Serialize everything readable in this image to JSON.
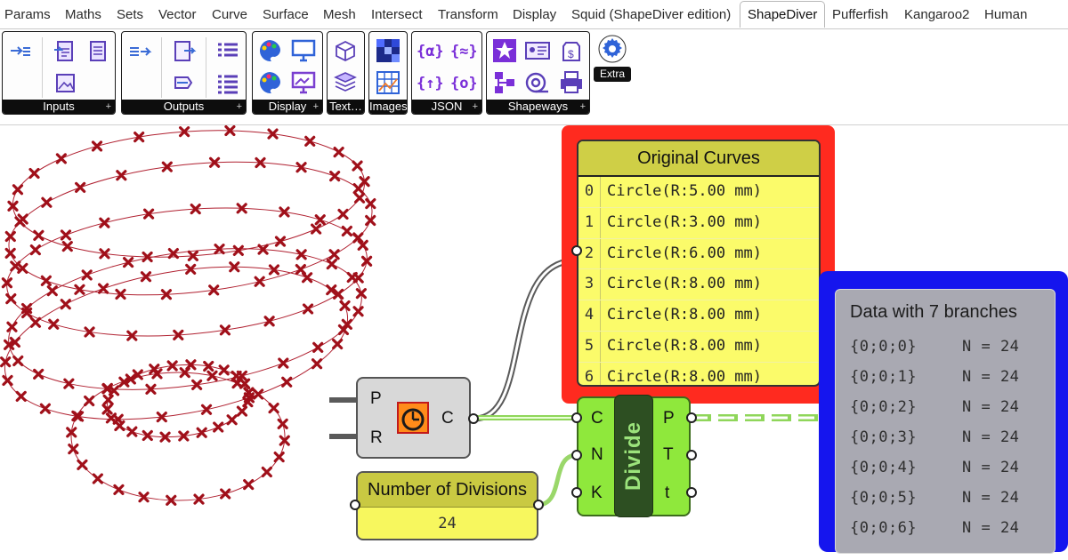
{
  "tabs": [
    {
      "label": "Params"
    },
    {
      "label": "Maths"
    },
    {
      "label": "Sets"
    },
    {
      "label": "Vector"
    },
    {
      "label": "Curve"
    },
    {
      "label": "Surface"
    },
    {
      "label": "Mesh"
    },
    {
      "label": "Intersect"
    },
    {
      "label": "Transform"
    },
    {
      "label": "Display"
    },
    {
      "label": "Squid (ShapeDiver edition)"
    },
    {
      "label": "ShapeDiver",
      "active": true
    },
    {
      "label": "Pufferfish"
    },
    {
      "label": "Kangaroo2"
    },
    {
      "label": "Human"
    }
  ],
  "ribbon": {
    "panels": [
      {
        "label": "Inputs",
        "icons": [
          "input-arrow-icon",
          "file-input-icon",
          "file-text-icon",
          "image-input-icon"
        ]
      },
      {
        "label": "Outputs",
        "icons": [
          "output-arrow-icon",
          "file-output-icon",
          "export-arrow-icon",
          "list-output-icon",
          "list-output-2-icon"
        ]
      },
      {
        "label": "Display",
        "icons": [
          "palette-icon",
          "monitor-icon",
          "palette-2-icon",
          "screen-display-icon"
        ]
      },
      {
        "label": "Text…",
        "icons": [
          "texture-box-icon",
          "texture-stack-icon"
        ]
      },
      {
        "label": "Images",
        "icons": [
          "image-grid-icon",
          "image-mesh-icon"
        ]
      },
      {
        "label": "JSON",
        "icons": [
          "json-object-icon",
          "json-array-icon",
          "json-list-icon",
          "json-dict-icon"
        ]
      },
      {
        "label": "Shapeways",
        "icons": [
          "shapeways-star-icon",
          "contact-card-icon",
          "price-tag-icon",
          "hierarchy-icon",
          "material-roll-icon",
          "printer-icon"
        ]
      }
    ],
    "extra_label": "Extra"
  },
  "components": {
    "original_curves": {
      "title": "Original Curves",
      "items": [
        {
          "index": "0",
          "value": "Circle(R:5.00 mm)"
        },
        {
          "index": "1",
          "value": "Circle(R:3.00 mm)"
        },
        {
          "index": "2",
          "value": "Circle(R:6.00 mm)"
        },
        {
          "index": "3",
          "value": "Circle(R:8.00 mm)"
        },
        {
          "index": "4",
          "value": "Circle(R:8.00 mm)"
        },
        {
          "index": "5",
          "value": "Circle(R:8.00 mm)"
        },
        {
          "index": "6",
          "value": "Circle(R:8.00 mm)"
        }
      ]
    },
    "data_panel": {
      "title": "Data with 7 branches",
      "rows": [
        {
          "path": "{0;0;0}",
          "count": "N = 24"
        },
        {
          "path": "{0;0;1}",
          "count": "N = 24"
        },
        {
          "path": "{0;0;2}",
          "count": "N = 24"
        },
        {
          "path": "{0;0;3}",
          "count": "N = 24"
        },
        {
          "path": "{0;0;4}",
          "count": "N = 24"
        },
        {
          "path": "{0;0;5}",
          "count": "N = 24"
        },
        {
          "path": "{0;0;6}",
          "count": "N = 24"
        }
      ]
    },
    "circle": {
      "inputs": [
        "P",
        "R"
      ],
      "outputs": [
        "C"
      ],
      "icon": "circle-component-icon"
    },
    "divide": {
      "name": "Divide",
      "inputs": [
        "C",
        "N",
        "K"
      ],
      "outputs": [
        "P",
        "T",
        "t"
      ]
    },
    "number_slider": {
      "title": "Number of Divisions",
      "value": "24"
    }
  },
  "colors": {
    "red_group": "#ff2a1f",
    "blue_group": "#1515ee",
    "panel_yellow": "#fbfb6a",
    "divide_green": "#8fe83c",
    "point_marker": "#a0101a",
    "circle_stroke": "#b02030"
  }
}
